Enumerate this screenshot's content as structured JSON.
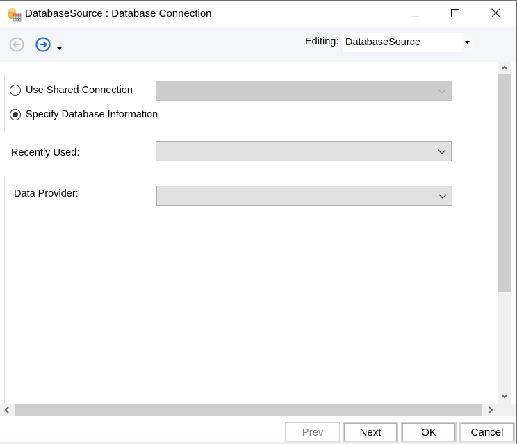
{
  "window": {
    "title": "DatabaseSource : Database Connection",
    "icon": "database-table-icon",
    "controls": {
      "minimize": "minimize-icon",
      "maximize": "maximize-icon",
      "close": "close-icon"
    }
  },
  "toolbar": {
    "back_icon": "back-arrow-icon",
    "forward_icon": "forward-arrow-icon",
    "dropdown_icon": "caret-down-icon",
    "editing_label": "Editing:",
    "editing_value": "DatabaseSource"
  },
  "connection": {
    "options": [
      {
        "label": "Use Shared Connection",
        "checked": false
      },
      {
        "label": "Specify Database Information",
        "checked": true
      }
    ],
    "shared_connection_value": ""
  },
  "recently_used": {
    "label": "Recently Used:",
    "value": ""
  },
  "data_provider": {
    "label": "Data Provider:",
    "value": ""
  },
  "footer": {
    "prev": "Prev",
    "next": "Next",
    "ok": "OK",
    "cancel": "Cancel"
  },
  "colors": {
    "accent": "#2b6cc4",
    "toolbar_bg": "#f3f5f8",
    "disabled_combo": "#cccccc",
    "combo_bg": "#e1e1e1",
    "scrollbar_thumb": "#cdcdcd"
  }
}
